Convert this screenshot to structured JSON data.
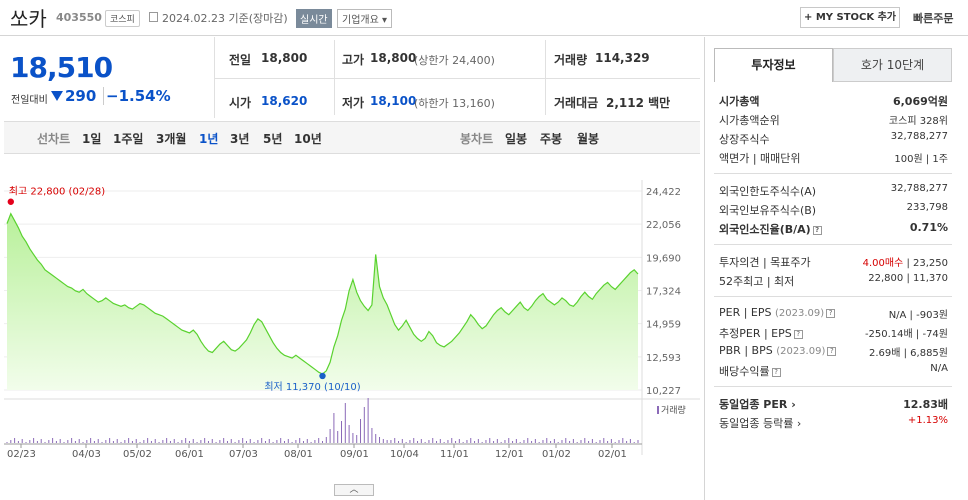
{
  "header": {
    "name": "쏘카",
    "code": "403550",
    "market": "코스피",
    "date": "2024.02.23  기준(장마감)",
    "realtime": "실시간",
    "overview": "기업개요 ▾",
    "mystock": "+ MY STOCK 추가",
    "quick_order": "빠른주문"
  },
  "price": {
    "current": "18,510",
    "change_label": "전일대비",
    "change": "290",
    "change_pct": "−1.54%"
  },
  "summary": {
    "prev_lbl": "전일",
    "prev": "18,800",
    "high_lbl": "고가",
    "high": "18,800",
    "upper_limit": "(상한가 24,400)",
    "volume_lbl": "거래량",
    "volume": "114,329",
    "open_lbl": "시가",
    "open": "18,620",
    "low_lbl": "저가",
    "low": "18,100",
    "lower_limit": "(하한가 13,160)",
    "amount_lbl": "거래대금",
    "amount": "2,112 백만"
  },
  "tabs": {
    "line_label": "선차트",
    "line_items": [
      "1일",
      "1주일",
      "3개월",
      "1년",
      "3년",
      "5년",
      "10년"
    ],
    "active": "1년",
    "candle_label": "봉차트",
    "candle_items": [
      "일봉",
      "주봉",
      "월봉"
    ]
  },
  "chart_data": {
    "type": "area",
    "y_ticks": [
      "24,422",
      "22,056",
      "19,690",
      "17,324",
      "14,959",
      "12,593",
      "10,227"
    ],
    "ylim": [
      10227,
      24422
    ],
    "x_ticks": [
      "02/23",
      "04/03",
      "05/02",
      "06/01",
      "07/03",
      "08/01",
      "09/01",
      "10/04",
      "11/01",
      "12/01",
      "01/02",
      "02/01"
    ],
    "high_label": "최고 22,800 (02/28)",
    "low_label": "최저 11,370 (10/10)",
    "volume_label": "거래량",
    "prices": [
      22100,
      22800,
      22300,
      21800,
      21200,
      20800,
      20300,
      19900,
      19500,
      19200,
      18800,
      18600,
      18400,
      18200,
      18000,
      17800,
      17600,
      17500,
      17300,
      17200,
      17400,
      17100,
      16900,
      16700,
      16500,
      16600,
      16800,
      16600,
      16400,
      16300,
      16200,
      16300,
      16100,
      16000,
      16200,
      16400,
      16300,
      16100,
      15900,
      15700,
      15600,
      15500,
      15300,
      15100,
      14900,
      14700,
      14500,
      14400,
      14300,
      14500,
      14200,
      13700,
      13300,
      13000,
      12900,
      13200,
      13500,
      13700,
      13400,
      13100,
      13000,
      13200,
      13500,
      13800,
      14300,
      14900,
      15300,
      15100,
      14600,
      14100,
      13600,
      13200,
      12900,
      12700,
      12600,
      12500,
      12700,
      12500,
      12300,
      12100,
      11900,
      11700,
      11500,
      11370,
      11600,
      12200,
      13300,
      14100,
      15200,
      16000,
      17300,
      18100,
      17200,
      16600,
      16200,
      15900,
      16300,
      19900,
      17600,
      16800,
      16300,
      15600,
      14900,
      14500,
      14800,
      15200,
      14700,
      14200,
      13900,
      13700,
      13900,
      14400,
      14100,
      13600,
      13400,
      13300,
      13500,
      13700,
      14000,
      14300,
      14700,
      15100,
      15600,
      15300,
      14900,
      14600,
      14800,
      15200,
      15600,
      15900,
      16100,
      15800,
      15600,
      15900,
      16200,
      16500,
      16100,
      15900,
      16200,
      16600,
      16900,
      17100,
      16700,
      16500,
      16300,
      16500,
      16800,
      16600,
      16300,
      16200,
      16500,
      16900,
      17200,
      16900,
      16700,
      17100,
      17400,
      17700,
      17900,
      17600,
      17400,
      17700,
      18000,
      18300,
      18600,
      18800,
      18500
    ]
  },
  "info": {
    "tab1": "투자정보",
    "tab2": "호가 10단계",
    "market_cap_lbl": "시가총액",
    "market_cap": "6,069억원",
    "cap_rank_lbl": "시가총액순위",
    "cap_rank": "코스피 328위",
    "shares_lbl": "상장주식수",
    "shares": "32,788,277",
    "par_lbl": "액면가 | 매매단위",
    "par": "100원 | 1주",
    "foreign_limit_lbl": "외국인한도주식수(A)",
    "foreign_limit": "32,788,277",
    "foreign_hold_lbl": "외국인보유주식수(B)",
    "foreign_hold": "233,798",
    "foreign_ratio_lbl": "외국인소진율(B/A)",
    "foreign_ratio": "0.71%",
    "opinion_lbl": "투자의견 | 목표주가",
    "opinion": "4.00매수",
    "target": "23,250",
    "w52_lbl": "52주최고 | 최저",
    "w52": "22,800 | 11,370",
    "per_lbl": "PER | EPS",
    "per_period": "(2023.09)",
    "per": "N/A | -903원",
    "est_per_lbl": "추정PER | EPS",
    "est_per": "-250.14배 | -74원",
    "pbr_lbl": "PBR | BPS",
    "pbr_period": "(2023.09)",
    "pbr": "2.69배 | 6,885원",
    "div_lbl": "배당수익률",
    "div": "N/A",
    "ind_per_lbl": "동일업종 PER",
    "ind_per": "12.83배",
    "ind_chg_lbl": "동일업종 등락률",
    "ind_chg": "+1.13%"
  },
  "bottom_handle": "︿"
}
